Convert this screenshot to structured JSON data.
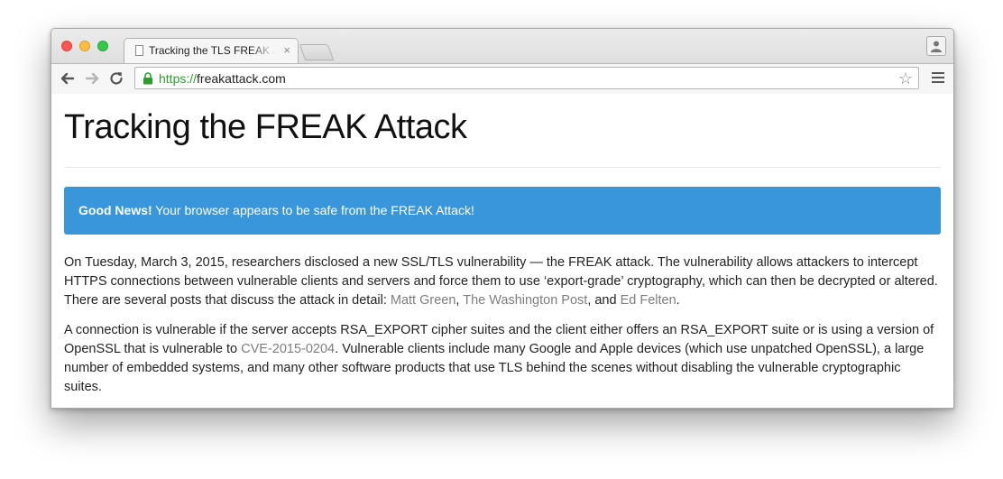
{
  "browser": {
    "tab_title": "Tracking the TLS FREAK Attack",
    "tab_close": "×",
    "url_scheme": "https://",
    "url_host": "freakattack.com"
  },
  "page": {
    "heading": "Tracking the FREAK Attack",
    "alert": {
      "strong": "Good News!",
      "text": " Your browser appears to be safe from the FREAK Attack!"
    },
    "para1": {
      "text": "On Tuesday, March 3, 2015, researchers disclosed a new SSL/TLS vulnerability — the FREAK attack. The vulnerability allows attackers to intercept HTTPS connections between vulnerable clients and servers and force them to use ‘export-grade’ cryptography, which can then be decrypted or altered. There are several posts that discuss the attack in detail: ",
      "link1": "Matt Green",
      "sep1": ", ",
      "link2": "The Washington Post",
      "sep2": ", and ",
      "link3": "Ed Felten",
      "end": "."
    },
    "para2": {
      "text": "A connection is vulnerable if the server accepts RSA_EXPORT cipher suites and the client either offers an RSA_EXPORT suite or is using a version of OpenSSL that is vulnerable to ",
      "link": "CVE-2015-0204",
      "rest": ". Vulnerable clients include many Google and Apple devices (which use unpatched OpenSSL), a large number of embedded systems, and many other software products that use TLS behind the scenes without disabling the vulnerable cryptographic suites."
    }
  },
  "colors": {
    "alert_bg": "#3a96db",
    "link": "#7d7d7d",
    "secure_green": "#2d9e2d"
  },
  "icons": [
    "document-icon",
    "lock-icon",
    "star-icon",
    "menu-icon",
    "profile-icon",
    "back-icon",
    "forward-icon",
    "reload-icon"
  ]
}
